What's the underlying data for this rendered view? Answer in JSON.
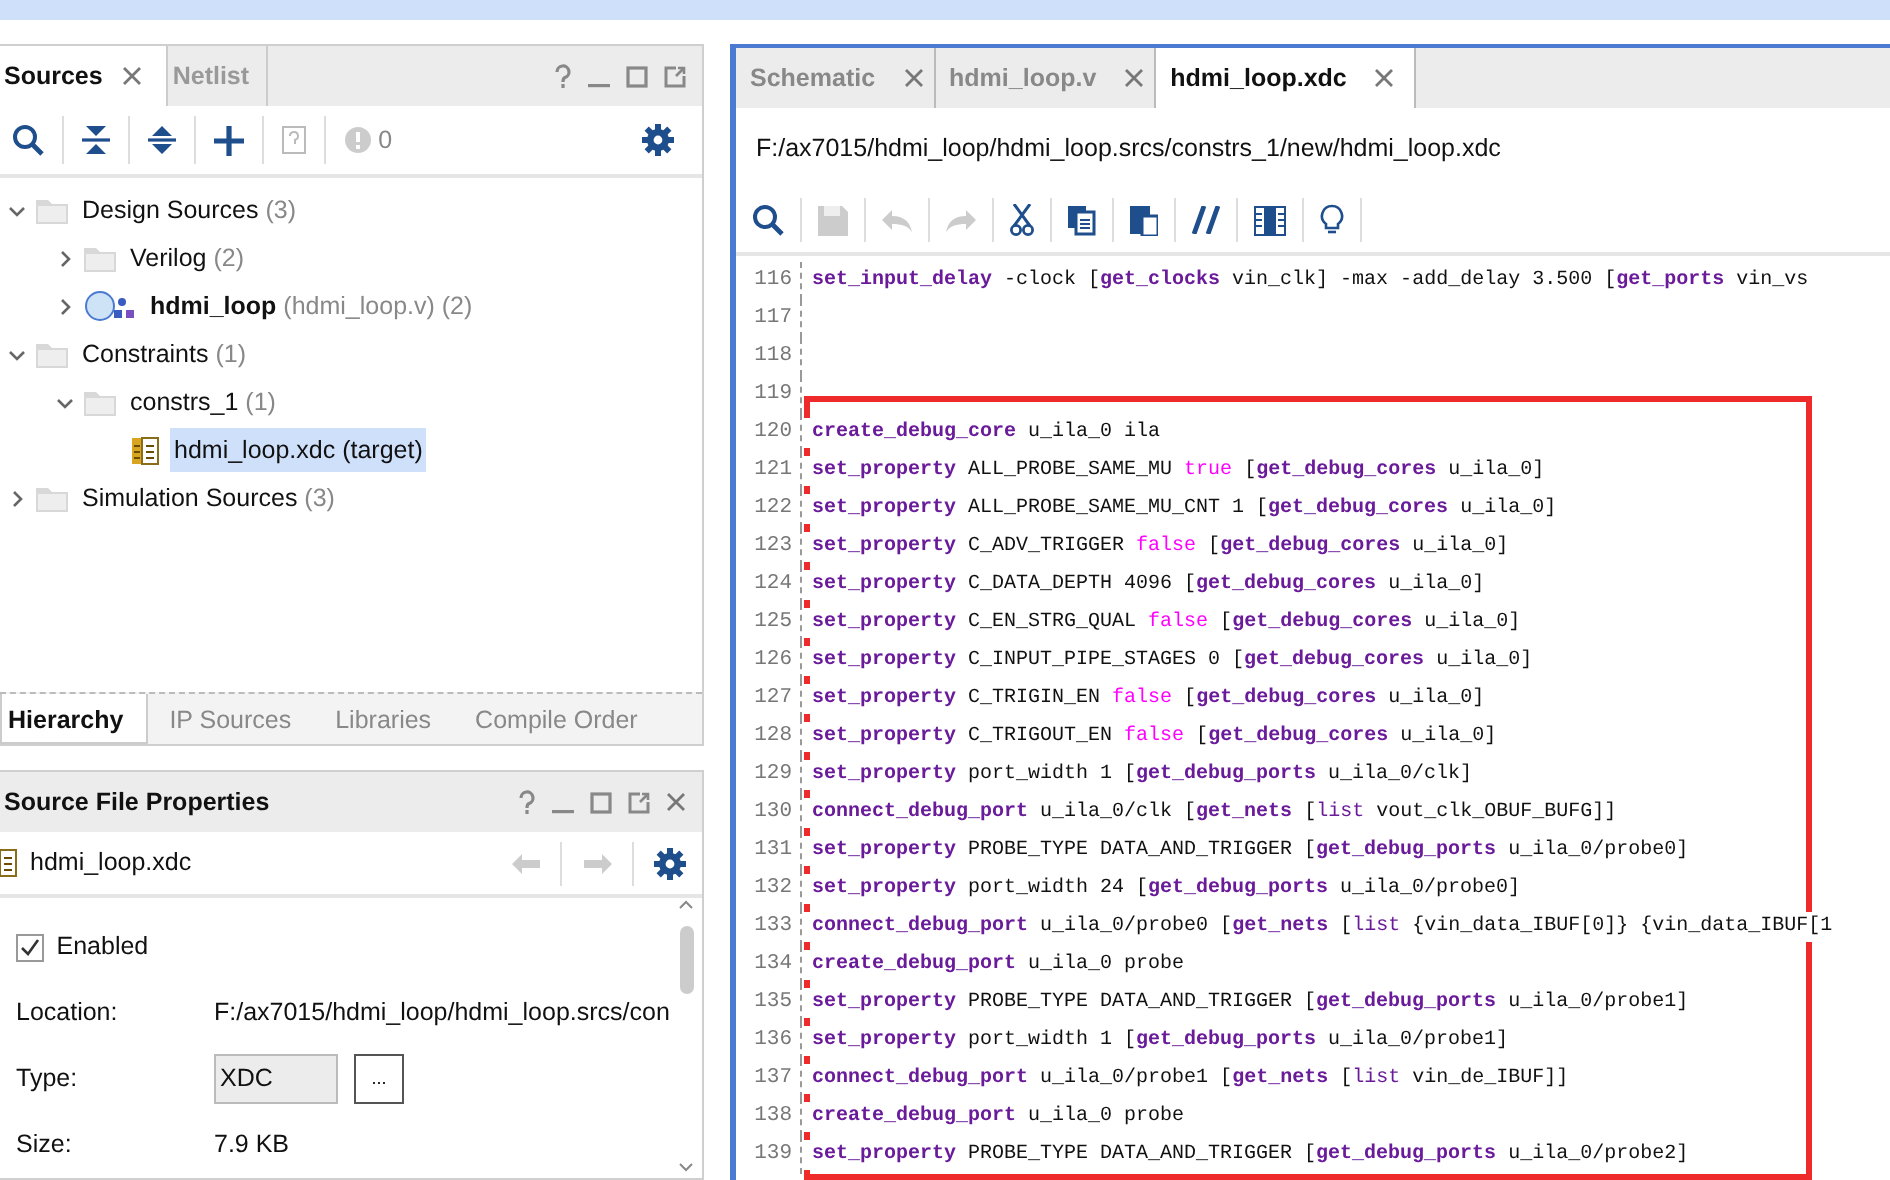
{
  "sources_panel": {
    "tabs": [
      {
        "label": "Sources",
        "selected": true,
        "closable": true
      },
      {
        "label": "Netlist",
        "selected": false,
        "closable": false
      }
    ],
    "toolbar": {
      "message_count": "0"
    },
    "tree": [
      {
        "kind": "folder",
        "label": "Design Sources",
        "count": "(3)",
        "expanded": true,
        "selected": false,
        "children": [
          {
            "kind": "folder",
            "label": "Verilog",
            "count": "(2)",
            "expanded": false,
            "selected": false
          },
          {
            "kind": "module",
            "label": "hdmi_loop",
            "detail": "(hdmi_loop.v)",
            "count": "(2)",
            "expanded": false,
            "selected": false
          }
        ]
      },
      {
        "kind": "folder",
        "label": "Constraints",
        "count": "(1)",
        "expanded": true,
        "selected": false,
        "children": [
          {
            "kind": "folder",
            "label": "constrs_1",
            "count": "(1)",
            "expanded": true,
            "selected": false,
            "children": [
              {
                "kind": "file",
                "label": "hdmi_loop.xdc (target)",
                "selected": true
              }
            ]
          }
        ]
      },
      {
        "kind": "folder",
        "label": "Simulation Sources",
        "count": "(3)",
        "expanded": false,
        "selected": false
      }
    ],
    "bottom_tabs": [
      {
        "label": "Hierarchy",
        "selected": true
      },
      {
        "label": "IP Sources",
        "selected": false
      },
      {
        "label": "Libraries",
        "selected": false
      },
      {
        "label": "Compile Order",
        "selected": false
      }
    ]
  },
  "properties_panel": {
    "title": "Source File Properties",
    "file": "hdmi_loop.xdc",
    "enabled": {
      "label": "Enabled",
      "checked": true
    },
    "fields": [
      {
        "label": "Location:",
        "value": "F:/ax7015/hdmi_loop/hdmi_loop.srcs/con",
        "kind": "text"
      },
      {
        "label": "Type:",
        "value": "XDC",
        "kind": "select",
        "button": "..."
      },
      {
        "label": "Size:",
        "value": "7.9 KB",
        "kind": "text"
      }
    ]
  },
  "editor": {
    "tabs": [
      {
        "label": "Schematic",
        "selected": false
      },
      {
        "label": "hdmi_loop.v",
        "selected": false
      },
      {
        "label": "hdmi_loop.xdc",
        "selected": true
      }
    ],
    "path": "F:/ax7015/hdmi_loop/hdmi_loop.srcs/constrs_1/new/hdmi_loop.xdc",
    "lines": [
      {
        "number": "116",
        "highlighted": false,
        "segments": [
          {
            "kind": "command",
            "text": "set_input_delay"
          },
          {
            "kind": "plain",
            "text": " -clock ["
          },
          {
            "kind": "command",
            "text": "get_clocks"
          },
          {
            "kind": "plain",
            "text": " vin_clk] -max -add_delay 3.500 ["
          },
          {
            "kind": "command",
            "text": "get_ports"
          },
          {
            "kind": "plain",
            "text": " vin_vs"
          }
        ]
      },
      {
        "number": "117",
        "highlighted": false
      },
      {
        "number": "118",
        "highlighted": false
      },
      {
        "number": "119",
        "highlighted": false
      },
      {
        "number": "120",
        "highlighted": true,
        "segments": [
          {
            "kind": "command",
            "text": "create_debug_core"
          },
          {
            "kind": "plain",
            "text": " u_ila_0 ila"
          }
        ]
      },
      {
        "number": "121",
        "highlighted": true,
        "segments": [
          {
            "kind": "command",
            "text": "set_property"
          },
          {
            "kind": "plain",
            "text": " ALL_PROBE_SAME_MU "
          },
          {
            "kind": "literal",
            "text": "true"
          },
          {
            "kind": "plain",
            "text": " ["
          },
          {
            "kind": "command",
            "text": "get_debug_cores"
          },
          {
            "kind": "plain",
            "text": " u_ila_0]"
          }
        ]
      },
      {
        "number": "122",
        "highlighted": true,
        "segments": [
          {
            "kind": "command",
            "text": "set_property"
          },
          {
            "kind": "plain",
            "text": " ALL_PROBE_SAME_MU_CNT 1 ["
          },
          {
            "kind": "command",
            "text": "get_debug_cores"
          },
          {
            "kind": "plain",
            "text": " u_ila_0]"
          }
        ]
      },
      {
        "number": "123",
        "highlighted": true,
        "segments": [
          {
            "kind": "command",
            "text": "set_property"
          },
          {
            "kind": "plain",
            "text": " C_ADV_TRIGGER "
          },
          {
            "kind": "literal",
            "text": "false"
          },
          {
            "kind": "plain",
            "text": " ["
          },
          {
            "kind": "command",
            "text": "get_debug_cores"
          },
          {
            "kind": "plain",
            "text": " u_ila_0]"
          }
        ]
      },
      {
        "number": "124",
        "highlighted": true,
        "segments": [
          {
            "kind": "command",
            "text": "set_property"
          },
          {
            "kind": "plain",
            "text": " C_DATA_DEPTH 4096 ["
          },
          {
            "kind": "command",
            "text": "get_debug_cores"
          },
          {
            "kind": "plain",
            "text": " u_ila_0]"
          }
        ]
      },
      {
        "number": "125",
        "highlighted": true,
        "segments": [
          {
            "kind": "command",
            "text": "set_property"
          },
          {
            "kind": "plain",
            "text": " C_EN_STRG_QUAL "
          },
          {
            "kind": "literal",
            "text": "false"
          },
          {
            "kind": "plain",
            "text": " ["
          },
          {
            "kind": "command",
            "text": "get_debug_cores"
          },
          {
            "kind": "plain",
            "text": " u_ila_0]"
          }
        ]
      },
      {
        "number": "126",
        "highlighted": true,
        "segments": [
          {
            "kind": "command",
            "text": "set_property"
          },
          {
            "kind": "plain",
            "text": " C_INPUT_PIPE_STAGES 0 ["
          },
          {
            "kind": "command",
            "text": "get_debug_cores"
          },
          {
            "kind": "plain",
            "text": " u_ila_0]"
          }
        ]
      },
      {
        "number": "127",
        "highlighted": true,
        "segments": [
          {
            "kind": "command",
            "text": "set_property"
          },
          {
            "kind": "plain",
            "text": " C_TRIGIN_EN "
          },
          {
            "kind": "literal",
            "text": "false"
          },
          {
            "kind": "plain",
            "text": " ["
          },
          {
            "kind": "command",
            "text": "get_debug_cores"
          },
          {
            "kind": "plain",
            "text": " u_ila_0]"
          }
        ]
      },
      {
        "number": "128",
        "highlighted": true,
        "segments": [
          {
            "kind": "command",
            "text": "set_property"
          },
          {
            "kind": "plain",
            "text": " C_TRIGOUT_EN "
          },
          {
            "kind": "literal",
            "text": "false"
          },
          {
            "kind": "plain",
            "text": " ["
          },
          {
            "kind": "command",
            "text": "get_debug_cores"
          },
          {
            "kind": "plain",
            "text": " u_ila_0]"
          }
        ]
      },
      {
        "number": "129",
        "highlighted": true,
        "segments": [
          {
            "kind": "command",
            "text": "set_property"
          },
          {
            "kind": "plain",
            "text": " port_width 1 ["
          },
          {
            "kind": "command",
            "text": "get_debug_ports"
          },
          {
            "kind": "plain",
            "text": " u_ila_0/clk]"
          }
        ]
      },
      {
        "number": "130",
        "highlighted": true,
        "segments": [
          {
            "kind": "command",
            "text": "connect_debug_port"
          },
          {
            "kind": "plain",
            "text": " u_ila_0/clk ["
          },
          {
            "kind": "command",
            "text": "get_nets"
          },
          {
            "kind": "plain",
            "text": " ["
          },
          {
            "kind": "list",
            "text": "list"
          },
          {
            "kind": "plain",
            "text": " vout_clk_OBUF_BUFG]]"
          }
        ]
      },
      {
        "number": "131",
        "highlighted": true,
        "segments": [
          {
            "kind": "command",
            "text": "set_property"
          },
          {
            "kind": "plain",
            "text": " PROBE_TYPE DATA_AND_TRIGGER ["
          },
          {
            "kind": "command",
            "text": "get_debug_ports"
          },
          {
            "kind": "plain",
            "text": " u_ila_0/probe0]"
          }
        ]
      },
      {
        "number": "132",
        "highlighted": true,
        "segments": [
          {
            "kind": "command",
            "text": "set_property"
          },
          {
            "kind": "plain",
            "text": " port_width 24 ["
          },
          {
            "kind": "command",
            "text": "get_debug_ports"
          },
          {
            "kind": "plain",
            "text": " u_ila_0/probe0]"
          }
        ]
      },
      {
        "number": "133",
        "highlighted": true,
        "segments": [
          {
            "kind": "command",
            "text": "connect_debug_port"
          },
          {
            "kind": "plain",
            "text": " u_ila_0/probe0 ["
          },
          {
            "kind": "command",
            "text": "get_nets"
          },
          {
            "kind": "plain",
            "text": " ["
          },
          {
            "kind": "list",
            "text": "list"
          },
          {
            "kind": "plain",
            "text": " {vin_data_IBUF[0]} {vin_data_IBUF[1"
          }
        ]
      },
      {
        "number": "134",
        "highlighted": true,
        "segments": [
          {
            "kind": "command",
            "text": "create_debug_port"
          },
          {
            "kind": "plain",
            "text": " u_ila_0 probe"
          }
        ]
      },
      {
        "number": "135",
        "highlighted": true,
        "segments": [
          {
            "kind": "command",
            "text": "set_property"
          },
          {
            "kind": "plain",
            "text": " PROBE_TYPE DATA_AND_TRIGGER ["
          },
          {
            "kind": "command",
            "text": "get_debug_ports"
          },
          {
            "kind": "plain",
            "text": " u_ila_0/probe1]"
          }
        ]
      },
      {
        "number": "136",
        "highlighted": true,
        "segments": [
          {
            "kind": "command",
            "text": "set_property"
          },
          {
            "kind": "plain",
            "text": " port_width 1 ["
          },
          {
            "kind": "command",
            "text": "get_debug_ports"
          },
          {
            "kind": "plain",
            "text": " u_ila_0/probe1]"
          }
        ]
      },
      {
        "number": "137",
        "highlighted": true,
        "segments": [
          {
            "kind": "command",
            "text": "connect_debug_port"
          },
          {
            "kind": "plain",
            "text": " u_ila_0/probe1 ["
          },
          {
            "kind": "command",
            "text": "get_nets"
          },
          {
            "kind": "plain",
            "text": " ["
          },
          {
            "kind": "list",
            "text": "list"
          },
          {
            "kind": "plain",
            "text": " vin_de_IBUF]]"
          }
        ]
      },
      {
        "number": "138",
        "highlighted": true,
        "segments": [
          {
            "kind": "command",
            "text": "create_debug_port"
          },
          {
            "kind": "plain",
            "text": " u_ila_0 probe"
          }
        ]
      },
      {
        "number": "139",
        "highlighted": true,
        "segments": [
          {
            "kind": "command",
            "text": "set_property"
          },
          {
            "kind": "plain",
            "text": " PROBE_TYPE DATA_AND_TRIGGER ["
          },
          {
            "kind": "command",
            "text": "get_debug_ports"
          },
          {
            "kind": "plain",
            "text": " u_ila_0/probe2]"
          }
        ]
      }
    ]
  }
}
